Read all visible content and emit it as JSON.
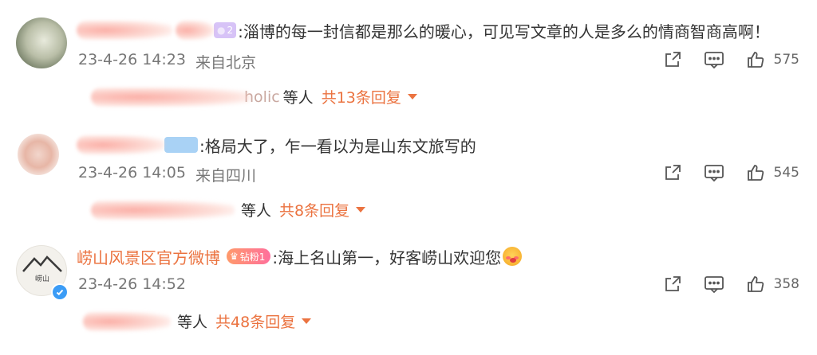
{
  "comments": [
    {
      "author_badge": "2",
      "text": ":淄博的每一封信都是那么的暖心，可见写文章的人是多么的情商智商高啊！",
      "time": "23-4-26 14:23",
      "location": "来自北京",
      "likes": "575",
      "replies_users": "holic",
      "replies_suffix": "等人",
      "replies_count": "共13条回复"
    },
    {
      "text": ":格局大了，乍一看以为是山东文旅写的",
      "time": "23-4-26 14:05",
      "location": "来自四川",
      "likes": "545",
      "replies_suffix": "等人",
      "replies_count": "共8条回复"
    },
    {
      "author_name": "崂山风景区官方微博",
      "author_badge": "钻粉1",
      "text": ":海上名山第一，好客崂山欢迎您",
      "time": "23-4-26 14:52",
      "likes": "358",
      "replies_suffix": "等人",
      "replies_count": "共48条回复"
    }
  ],
  "avatar3_text": "崂山",
  "icons": [
    "share-icon",
    "comment-icon",
    "like-icon",
    "verified-icon",
    "chevron-down-icon"
  ],
  "colors": {
    "accent": "#eb7340",
    "meta": "#777777",
    "verified": "#3b9cf6"
  }
}
